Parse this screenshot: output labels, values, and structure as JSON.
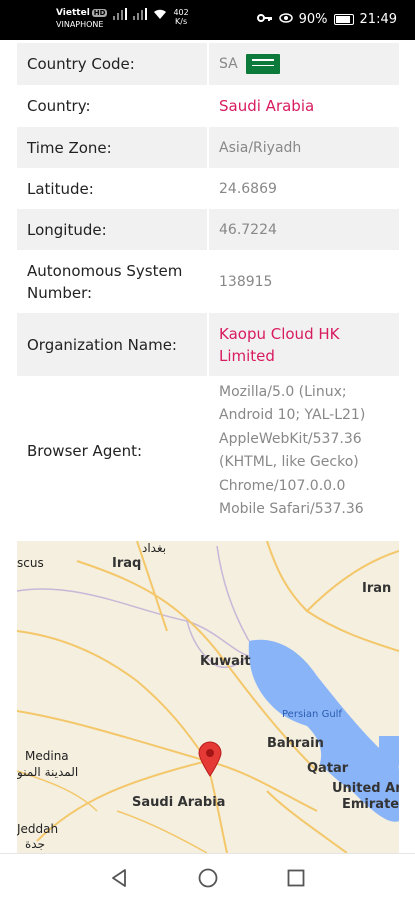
{
  "status_bar": {
    "carrier_1": "Viettel",
    "carrier_badge": "HD",
    "carrier_2": "VINAPHONE",
    "net_speed": "402",
    "net_unit": "K/s",
    "battery": "90%",
    "time": "21:49"
  },
  "info_rows": [
    {
      "label": "Country Code:",
      "value": "SA"
    },
    {
      "label": "Country:",
      "value": "Saudi Arabia"
    },
    {
      "label": "Time Zone:",
      "value": "Asia/Riyadh"
    },
    {
      "label": "Latitude:",
      "value": "24.6869"
    },
    {
      "label": "Longitude:",
      "value": "46.7224"
    },
    {
      "label": "Autonomous System Number:",
      "value": "138915"
    },
    {
      "label": "Organization Name:",
      "value": "Kaopu Cloud HK Limited"
    },
    {
      "label": "Browser Agent:",
      "value": "Mozilla/5.0 (Linux; Android 10; YAL-L21) AppleWebKit/537.36 (KHTML, like Gecko) Chrome/107.0.0.0 Mobile Safari/537.36"
    }
  ],
  "map": {
    "labels": {
      "baghdad": "بغداد",
      "iraq": "Iraq",
      "scus": "scus",
      "iran": "Iran",
      "kuwait": "Kuwait",
      "persian_gulf": "Persian Gulf",
      "bahrain": "Bahrain",
      "qatar": "Qatar",
      "uae": "United Ara",
      "emirates": "Emirates",
      "medina": "Medina",
      "medina_ar": "المدينة المنو",
      "saudi_arabia": "Saudi Arabia",
      "jeddah": "Jeddah",
      "jeddah_ar": "جدة"
    },
    "colors": {
      "land": "#f5efdf",
      "water": "#8ab4f8",
      "roads": "#f3c76a",
      "marker": "#e53935"
    }
  },
  "colors": {
    "highlight_text": "#d81b60",
    "row_grey": "#f1f1f1"
  }
}
